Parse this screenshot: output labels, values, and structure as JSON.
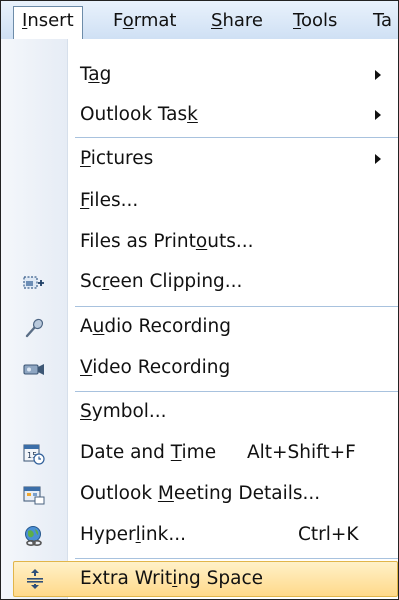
{
  "menubar": {
    "items": [
      {
        "pre": "",
        "u": "I",
        "post": "nsert"
      },
      {
        "pre": "F",
        "u": "o",
        "post": "rmat"
      },
      {
        "pre": "",
        "u": "S",
        "post": "hare"
      },
      {
        "pre": "",
        "u": "T",
        "post": "ools"
      },
      {
        "pre": "Ta",
        "u": "",
        "post": ""
      }
    ]
  },
  "menu": {
    "items": [
      {
        "pre": "T",
        "u": "a",
        "post": "g",
        "shortcut": ""
      },
      {
        "pre": "Outlook Tas",
        "u": "k",
        "post": "",
        "shortcut": ""
      },
      {
        "pre": "",
        "u": "P",
        "post": "ictures",
        "shortcut": ""
      },
      {
        "pre": "",
        "u": "F",
        "post": "iles...",
        "shortcut": ""
      },
      {
        "pre": "Files as Print",
        "u": "o",
        "post": "uts...",
        "shortcut": ""
      },
      {
        "pre": "Sc",
        "u": "r",
        "post": "een Clipping...",
        "shortcut": ""
      },
      {
        "pre": "A",
        "u": "u",
        "post": "dio Recording",
        "shortcut": ""
      },
      {
        "pre": "",
        "u": "V",
        "post": "ideo Recording",
        "shortcut": ""
      },
      {
        "pre": "",
        "u": "S",
        "post": "ymbol...",
        "shortcut": ""
      },
      {
        "pre": "Date and ",
        "u": "T",
        "post": "ime",
        "shortcut": "Alt+Shift+F"
      },
      {
        "pre": "Outlook ",
        "u": "M",
        "post": "eeting Details...",
        "shortcut": ""
      },
      {
        "pre": "Hyper",
        "u": "l",
        "post": "ink...",
        "shortcut": "Ctrl+K"
      },
      {
        "pre": "Extra Writ",
        "u": "i",
        "post": "ng Space",
        "shortcut": ""
      }
    ]
  },
  "colors": {
    "highlight": "#ffd98a",
    "menubar": "#cfe0f4",
    "separator": "#a8c2de"
  },
  "icons": {
    "screen_clipping": "screen-clipping-icon",
    "audio": "microphone-icon",
    "video": "video-camera-icon",
    "date_time": "calendar-clock-icon",
    "meeting": "meeting-details-icon",
    "hyperlink": "globe-link-icon",
    "extra_space": "expand-space-icon",
    "submenu": "submenu-arrow-icon"
  }
}
